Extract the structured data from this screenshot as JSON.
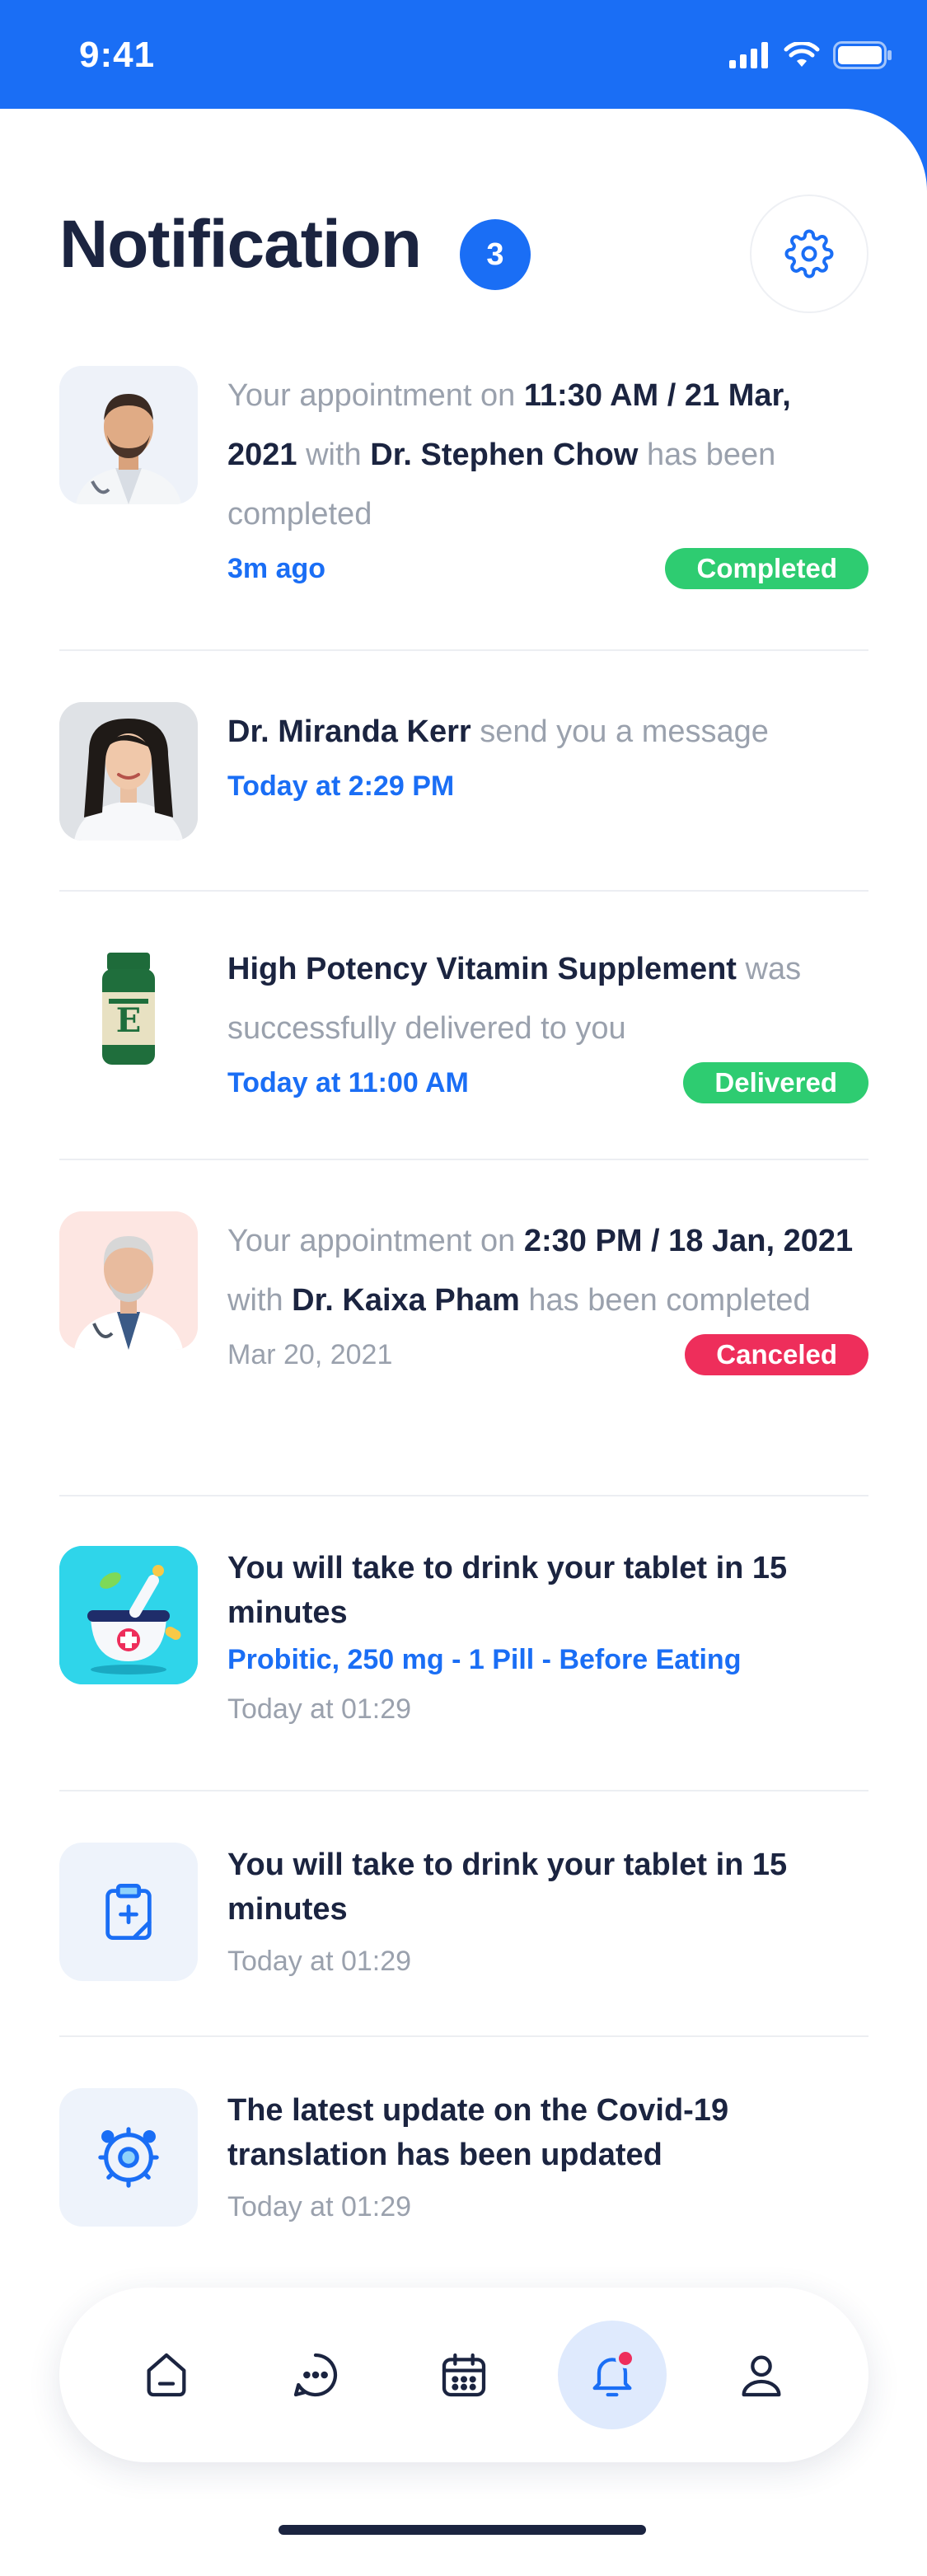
{
  "status_bar": {
    "time": "9:41"
  },
  "header": {
    "title": "Notification",
    "badge_count": "3"
  },
  "notifications": [
    {
      "type": "appointment",
      "text_1": "Your appointment on ",
      "time_slot": "11:30 AM / 21 Mar, 2021",
      "text_2": " with ",
      "doctor": "Dr. Stephen Chow",
      "text_3": " has been completed",
      "time": "3m ago",
      "status": "Completed"
    },
    {
      "type": "message",
      "doctor": "Dr. Miranda Kerr",
      "text_1": " send you a message",
      "time": "Today at 2:29 PM"
    },
    {
      "type": "delivery",
      "product": "High Potency Vitamin Supplement",
      "text_1": " was successfully delivered to you",
      "time": "Today at 11:00 AM",
      "status": "Delivered",
      "label_small": "E"
    },
    {
      "type": "appointment",
      "text_1": "Your appointment on ",
      "time_slot": "2:30 PM / 18 Jan, 2021",
      "text_2": " with ",
      "doctor": "Dr. Kaixa Pham",
      "text_3": " has been completed",
      "time": "Mar 20, 2021",
      "status": "Canceled"
    },
    {
      "type": "reminder",
      "title": "You will take to drink your tablet in 15 minutes",
      "detail": "Probitic, 250 mg - 1 Pill - Before Eating",
      "time": "Today at 01:29"
    },
    {
      "type": "reminder",
      "title": "You will take to drink your tablet in 15 minutes",
      "time": "Today at 01:29"
    },
    {
      "type": "update",
      "title": "The latest update on the Covid-19 translation has been updated",
      "time": "Today at 01:29"
    }
  ],
  "tabs": [
    {
      "name": "home",
      "icon": "home-icon"
    },
    {
      "name": "messages",
      "icon": "chat-icon"
    },
    {
      "name": "calendar",
      "icon": "calendar-icon"
    },
    {
      "name": "notifications",
      "icon": "bell-icon",
      "active": true
    },
    {
      "name": "profile",
      "icon": "user-icon"
    }
  ],
  "colors": {
    "primary": "#1a6ef5",
    "success": "#2ecc71",
    "danger": "#ee2e5b",
    "text": "#1b2440",
    "muted": "#9aa1ad"
  }
}
